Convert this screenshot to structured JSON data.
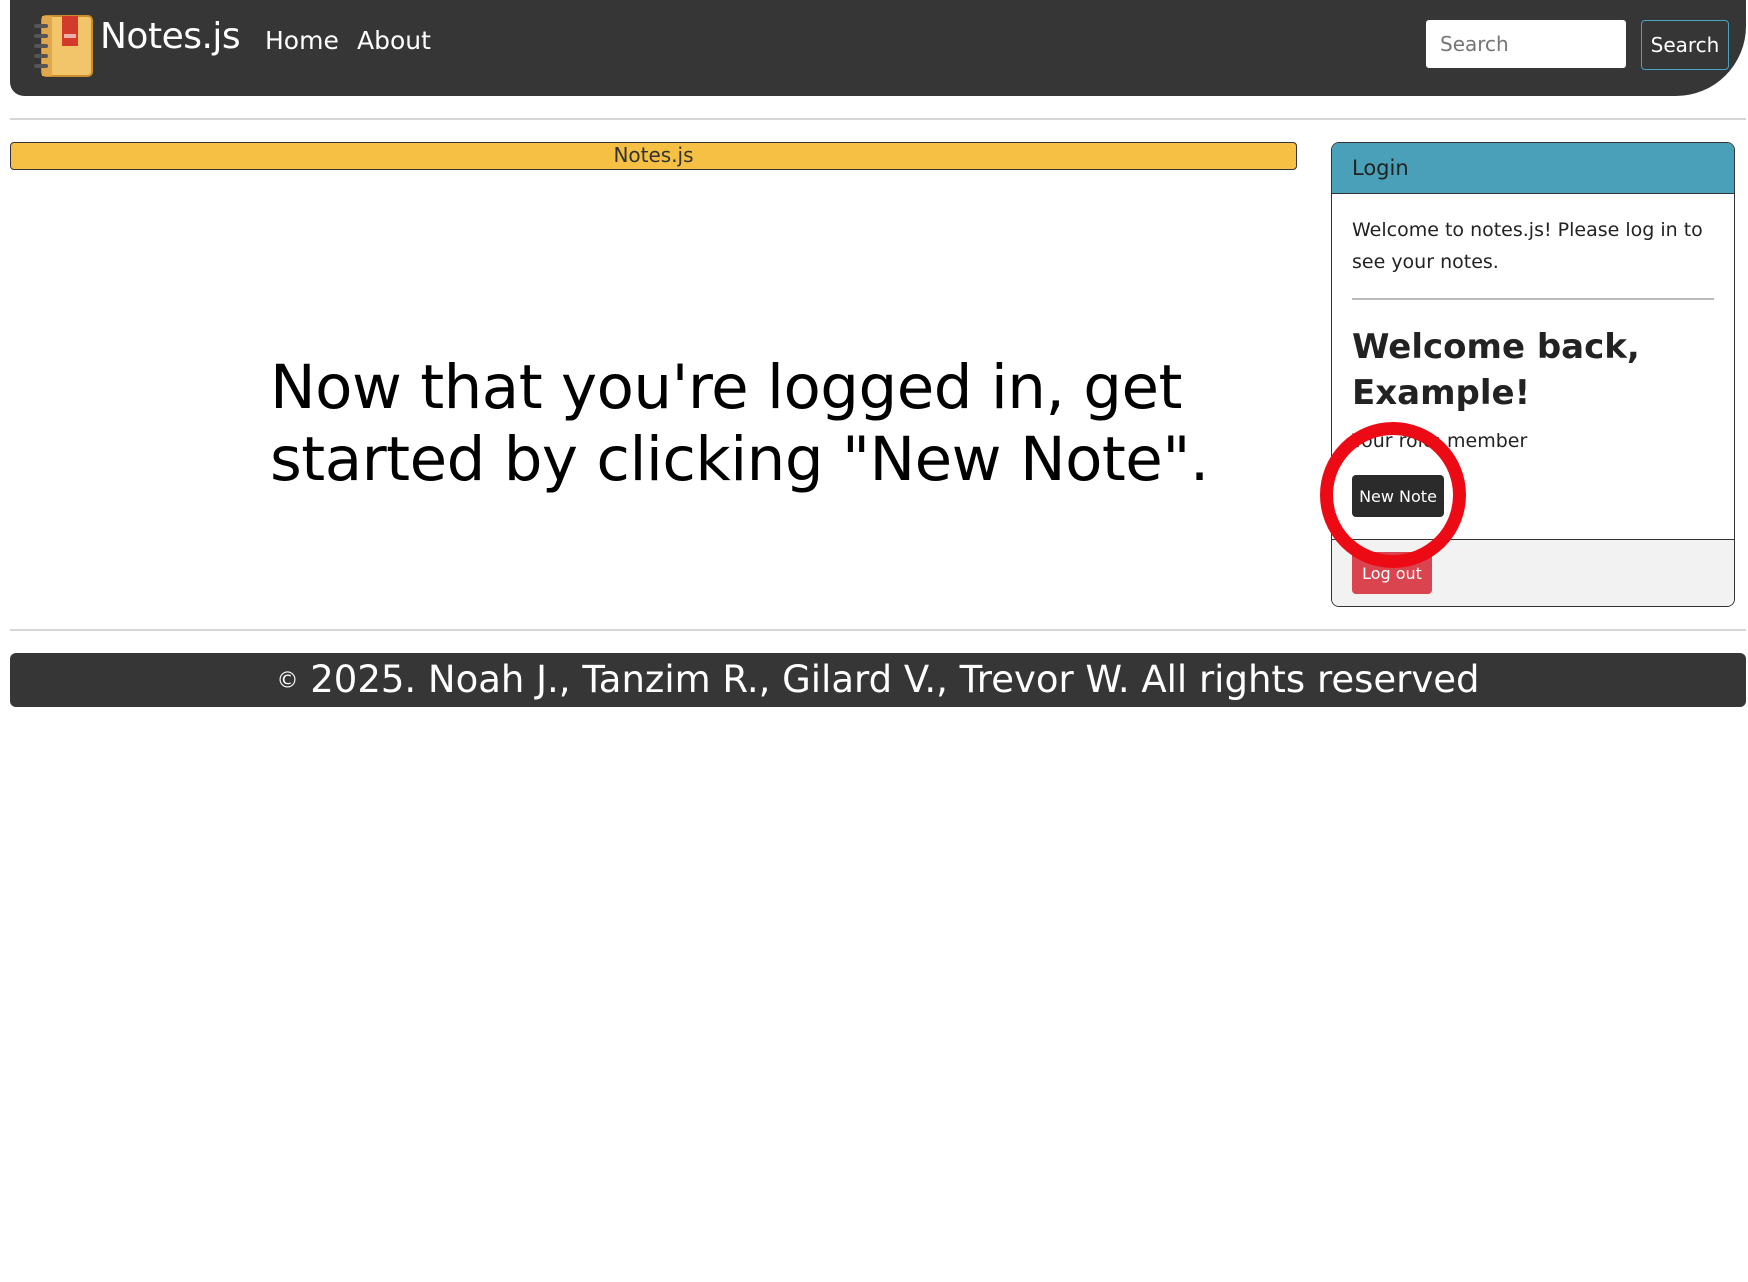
{
  "navbar": {
    "brand": "Notes.js",
    "links": [
      "Home",
      "About"
    ],
    "search_placeholder": "Search",
    "search_button": "Search"
  },
  "banner": {
    "title": "Notes.js"
  },
  "main": {
    "message": "Now that you're logged in, get started by clicking \"New Note\"."
  },
  "login_card": {
    "header": "Login",
    "welcome": "Welcome to notes.js! Please log in to see your notes.",
    "greeting": "Welcome back, Example!",
    "role_text": "Your role: member",
    "new_note_button": "New Note",
    "logout_button": "Log out"
  },
  "footer": {
    "copyright_symbol": "©",
    "text": "2025. Noah J., Tanzim R., Gilard V., Trevor W. All rights reserved"
  },
  "colors": {
    "navbar_bg": "#363636",
    "banner_bg": "#f5c043",
    "card_header_bg": "#4aa0b8",
    "logout_bg": "#d9444f",
    "highlight_ring": "#ec0b15"
  },
  "icons": {
    "brand": "notebook-icon"
  }
}
